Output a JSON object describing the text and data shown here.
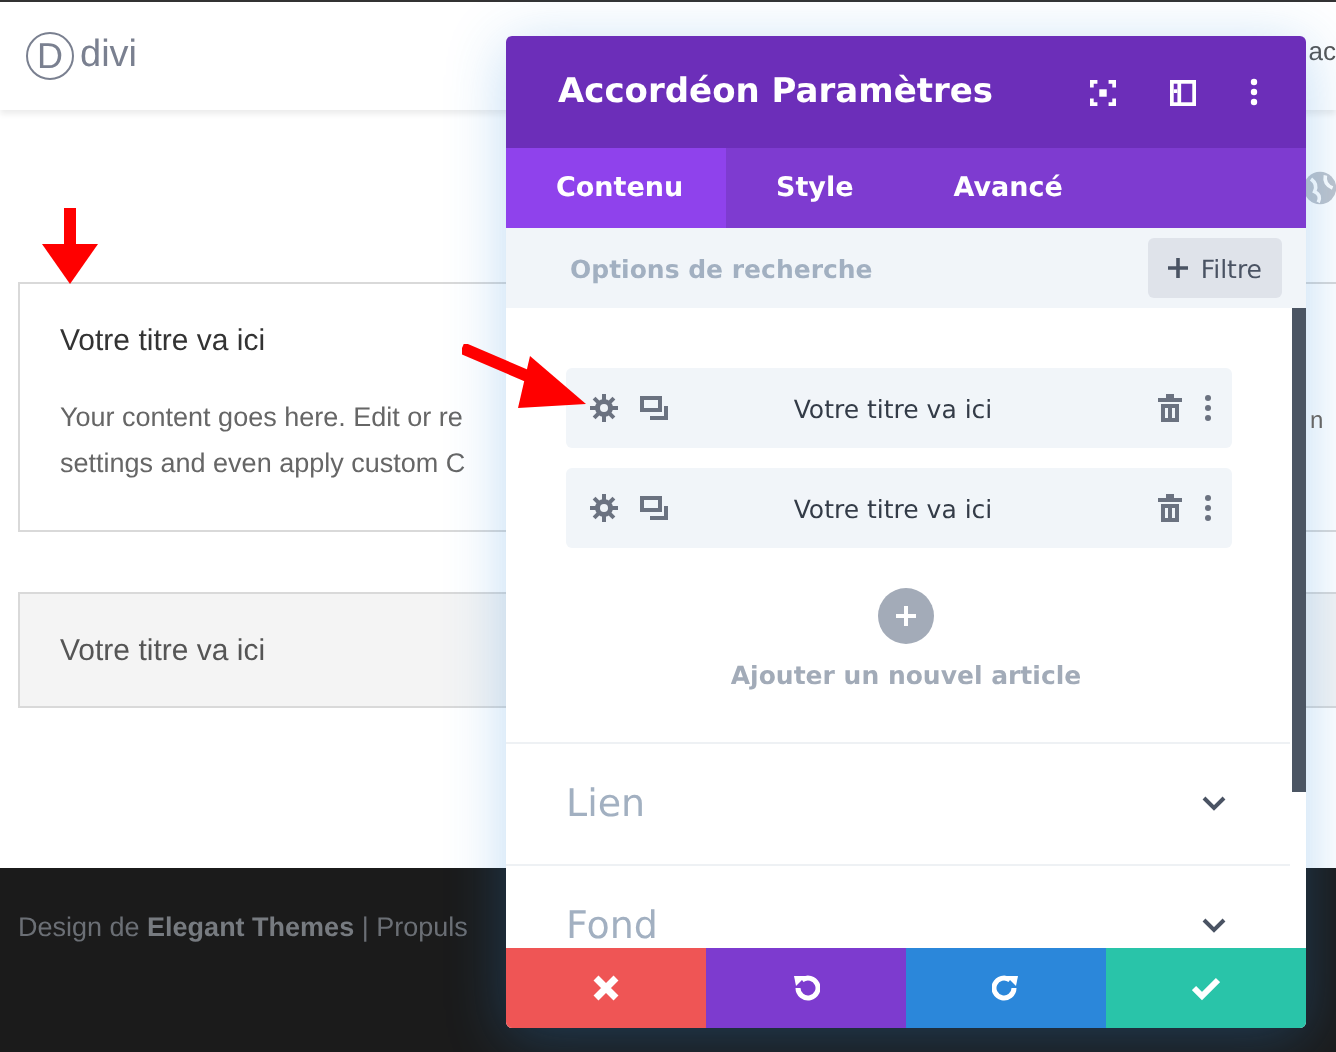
{
  "site": {
    "logo_letter": "D",
    "logo_text": "divi",
    "header_fragment": "ac"
  },
  "accordion": [
    {
      "title": "Votre titre va ici",
      "expanded": true,
      "content": [
        "Your content goes here. Edit or re",
        "settings and even apply custom C"
      ],
      "content_fragment": "n"
    },
    {
      "title": "Votre titre va ici",
      "expanded": false
    }
  ],
  "footer": {
    "text": "Design de **Elegant Themes** | Propuls"
  },
  "modal": {
    "title": "Accordéon Paramètres",
    "tabs": [
      {
        "label": "Contenu",
        "selected": true
      },
      {
        "label": "Style",
        "selected": false
      },
      {
        "label": "Avancé",
        "selected": false
      }
    ],
    "search": {
      "placeholder": "Options de recherche"
    },
    "filter_button": "Filtre",
    "items": [
      {
        "label": "Votre titre va ici"
      },
      {
        "label": "Votre titre va ici"
      }
    ],
    "add_label": "Ajouter un nouvel article",
    "sections": [
      {
        "label": "Lien",
        "expanded": false
      },
      {
        "label": "Fond",
        "expanded": false
      }
    ],
    "actions": [
      {
        "kind": "cancel",
        "color": "#ef5555"
      },
      {
        "kind": "undo",
        "color": "#7d3bcf"
      },
      {
        "kind": "redo",
        "color": "#2b87da"
      },
      {
        "kind": "save",
        "color": "#29c4a9"
      }
    ]
  }
}
